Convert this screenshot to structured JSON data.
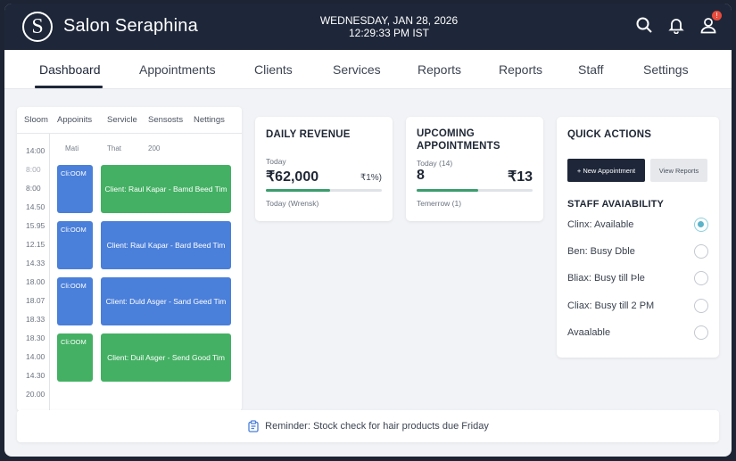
{
  "app": {
    "logo_letter": "S",
    "name": "Salon Seraphina",
    "date": "WEDNESDAY, JAN 28, 2026",
    "time": "12:29:33 PM IST",
    "notification_count": "!"
  },
  "nav": {
    "items": [
      "Dashboard",
      "Appointments",
      "Clients",
      "Services",
      "Reports",
      "Reports",
      "Staff",
      "Settings"
    ],
    "active": "Dashboard"
  },
  "calendar": {
    "tabs": [
      "Sloom",
      "Appoinits",
      "Servicle",
      "Sensosts",
      "Nettings"
    ],
    "columns": [
      "Mati",
      "That",
      "200"
    ],
    "times": [
      "14:00",
      "8:00",
      "8:00",
      "14.50",
      "15.95",
      "12.15",
      "14.33",
      "18.00",
      "18.07",
      "18.33",
      "18.30",
      "14.00",
      "14.30",
      "20.00"
    ],
    "events": [
      {
        "small": "Cli:OOM",
        "text": "Client: Raul Kapar - Bamd Beed Tim",
        "color": "green"
      },
      {
        "small": "Cli:OOM",
        "text": "Client: Raul Kapar - Bard Beed Tim",
        "color": "blue"
      },
      {
        "small": "Cli:OOM",
        "text": "Client: Duld Asger - Sand Geed Tim",
        "color": "blue"
      },
      {
        "small": "Cli:OOM",
        "text": "Client: Duil Asger - Send Good Tim",
        "color": "green"
      }
    ]
  },
  "revenue": {
    "title": "DAILY REVENUE",
    "sub_label": "Today",
    "amount": "₹62,000",
    "change": "₹1%)",
    "progress": 0.55,
    "footer": "Today (Wrensk)"
  },
  "upcoming": {
    "title_line1": "UPCOMING",
    "title_line2": "APPOINTMENTS",
    "sub_label": "Today (14)",
    "count": "8",
    "amount": "₹13",
    "progress": 0.53,
    "footer": "Temerrow (1)"
  },
  "quick_actions": {
    "title": "QUICK ACTIONS",
    "new_button": "+ New Appointment",
    "reports_button": "View Reports",
    "staff_title": "STAFF AVAIABILITY",
    "staff": [
      {
        "label": "Clinx: Available",
        "selected": true
      },
      {
        "label": "Ben: Busy Dble",
        "selected": false
      },
      {
        "label": "Bliax: Busy till Þle",
        "selected": false
      },
      {
        "label": "Cliax: Busy till 2 PM",
        "selected": false
      },
      {
        "label": "Avaalable",
        "selected": false
      }
    ]
  },
  "reminder": {
    "text": "Reminder: Stock check for hair products due Friday"
  },
  "colors": {
    "topbar": "#1e2739",
    "event_green": "#43b063",
    "event_blue": "#4a7fda",
    "progress": "#3a9d6d",
    "radio_selected": "#5bb3c9"
  }
}
